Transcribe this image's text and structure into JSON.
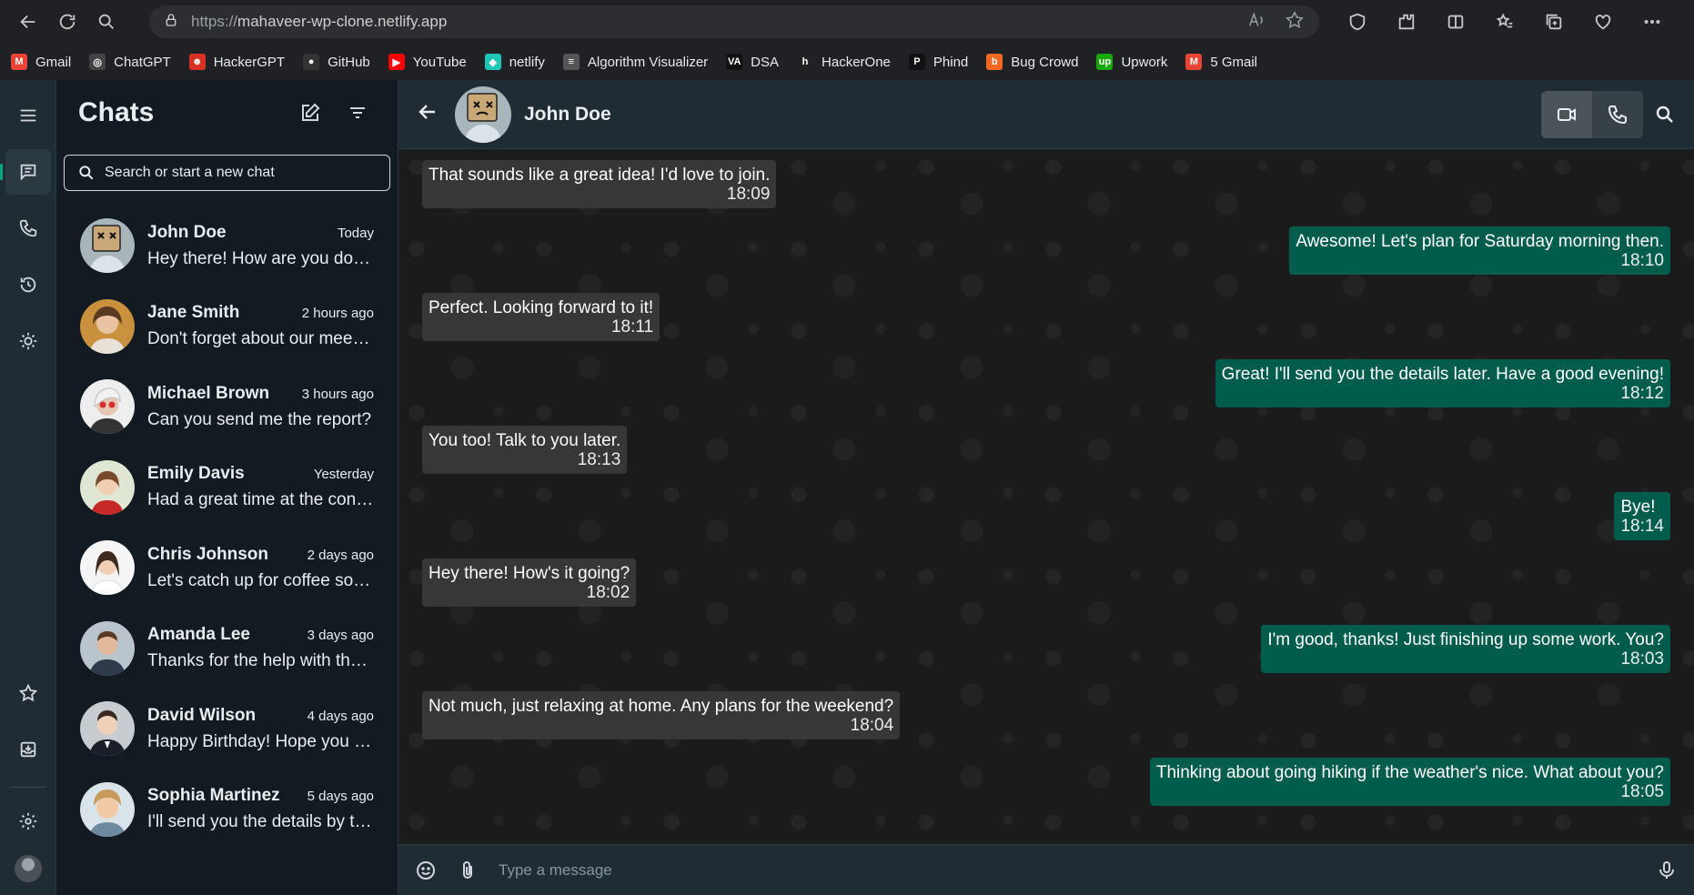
{
  "browser": {
    "url_scheme": "https://",
    "url_host": "mahaveer-wp-clone.netlify.app",
    "bookmarks": [
      {
        "label": "Gmail",
        "color": "#ea4335",
        "glyph": "M"
      },
      {
        "label": "ChatGPT",
        "color": "#444",
        "glyph": "◎"
      },
      {
        "label": "HackerGPT",
        "color": "#d93025",
        "glyph": "☻"
      },
      {
        "label": "GitHub",
        "color": "#333",
        "glyph": "●"
      },
      {
        "label": "YouTube",
        "color": "#ff0000",
        "glyph": "▶"
      },
      {
        "label": "netlify",
        "color": "#20c6b7",
        "glyph": "◆"
      },
      {
        "label": "Algorithm Visualizer",
        "color": "#555",
        "glyph": "≡"
      },
      {
        "label": "DSA",
        "color": "#111",
        "glyph": "VA"
      },
      {
        "label": "HackerOne",
        "color": "#222",
        "glyph": "h"
      },
      {
        "label": "Phind",
        "color": "#111",
        "glyph": "P"
      },
      {
        "label": "Bug Crowd",
        "color": "#f26822",
        "glyph": "b"
      },
      {
        "label": "Upwork",
        "color": "#14a800",
        "glyph": "up"
      },
      {
        "label": "5 Gmail",
        "color": "#ea4335",
        "glyph": "M"
      }
    ]
  },
  "sidebar": {
    "title": "Chats",
    "search_placeholder": "Search or start a new chat",
    "chats": [
      {
        "name": "John Doe",
        "time": "Today",
        "preview": "Hey there! How are you doing?"
      },
      {
        "name": "Jane Smith",
        "time": "2 hours ago",
        "preview": "Don't forget about our meeting tomorrow."
      },
      {
        "name": "Michael Brown",
        "time": "3 hours ago",
        "preview": "Can you send me the report?"
      },
      {
        "name": "Emily Davis",
        "time": "Yesterday",
        "preview": "Had a great time at the concert!"
      },
      {
        "name": "Chris Johnson",
        "time": "2 days ago",
        "preview": "Let's catch up for coffee soon."
      },
      {
        "name": "Amanda Lee",
        "time": "3 days ago",
        "preview": "Thanks for the help with the project."
      },
      {
        "name": "David Wilson",
        "time": "4 days ago",
        "preview": "Happy Birthday! Hope you have a great day."
      },
      {
        "name": "Sophia Martinez",
        "time": "5 days ago",
        "preview": "I'll send you the details by tonight."
      }
    ]
  },
  "conversation": {
    "contact_name": "John Doe",
    "composer_placeholder": "Type a message",
    "messages": [
      {
        "dir": "in",
        "text": "That sounds like a great idea! I'd love to join.",
        "time": "18:09"
      },
      {
        "dir": "out",
        "text": "Awesome! Let's plan for Saturday morning then.",
        "time": "18:10"
      },
      {
        "dir": "in",
        "text": "Perfect. Looking forward to it!",
        "time": "18:11"
      },
      {
        "dir": "out",
        "text": "Great! I'll send you the details later. Have a good evening!",
        "time": "18:12"
      },
      {
        "dir": "in",
        "text": "You too! Talk to you later.",
        "time": "18:13"
      },
      {
        "dir": "out",
        "text": "Bye!",
        "time": "18:14"
      },
      {
        "dir": "in",
        "text": "Hey there! How's it going?",
        "time": "18:02"
      },
      {
        "dir": "out",
        "text": "I'm good, thanks! Just finishing up some work. You?",
        "time": "18:03"
      },
      {
        "dir": "in",
        "text": "Not much, just relaxing at home. Any plans for the weekend?",
        "time": "18:04"
      },
      {
        "dir": "out",
        "text": "Thinking about going hiking if the weather's nice. What about you?",
        "time": "18:05"
      }
    ]
  },
  "colors": {
    "accent": "#00a884",
    "outgoing_bubble": "#005c4b",
    "incoming_bubble": "#373737"
  }
}
